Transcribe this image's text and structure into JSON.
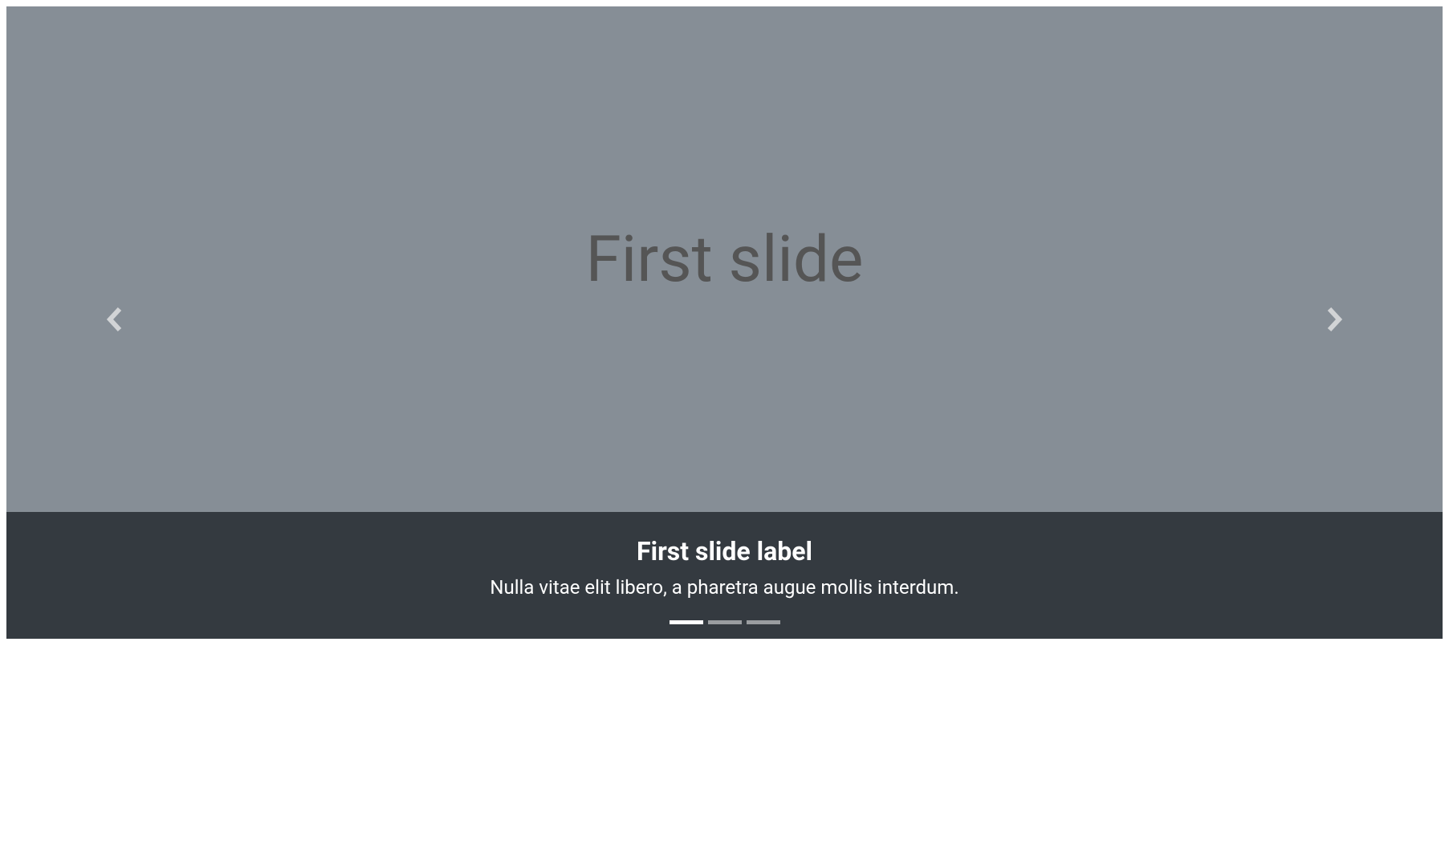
{
  "carousel": {
    "active_index": 0,
    "indicator_count": 3,
    "slide": {
      "image_text": "First slide",
      "caption_title": "First slide label",
      "caption_text": "Nulla vitae elit libero, a pharetra augue mollis interdum."
    },
    "prev_label": "Previous",
    "next_label": "Next"
  }
}
